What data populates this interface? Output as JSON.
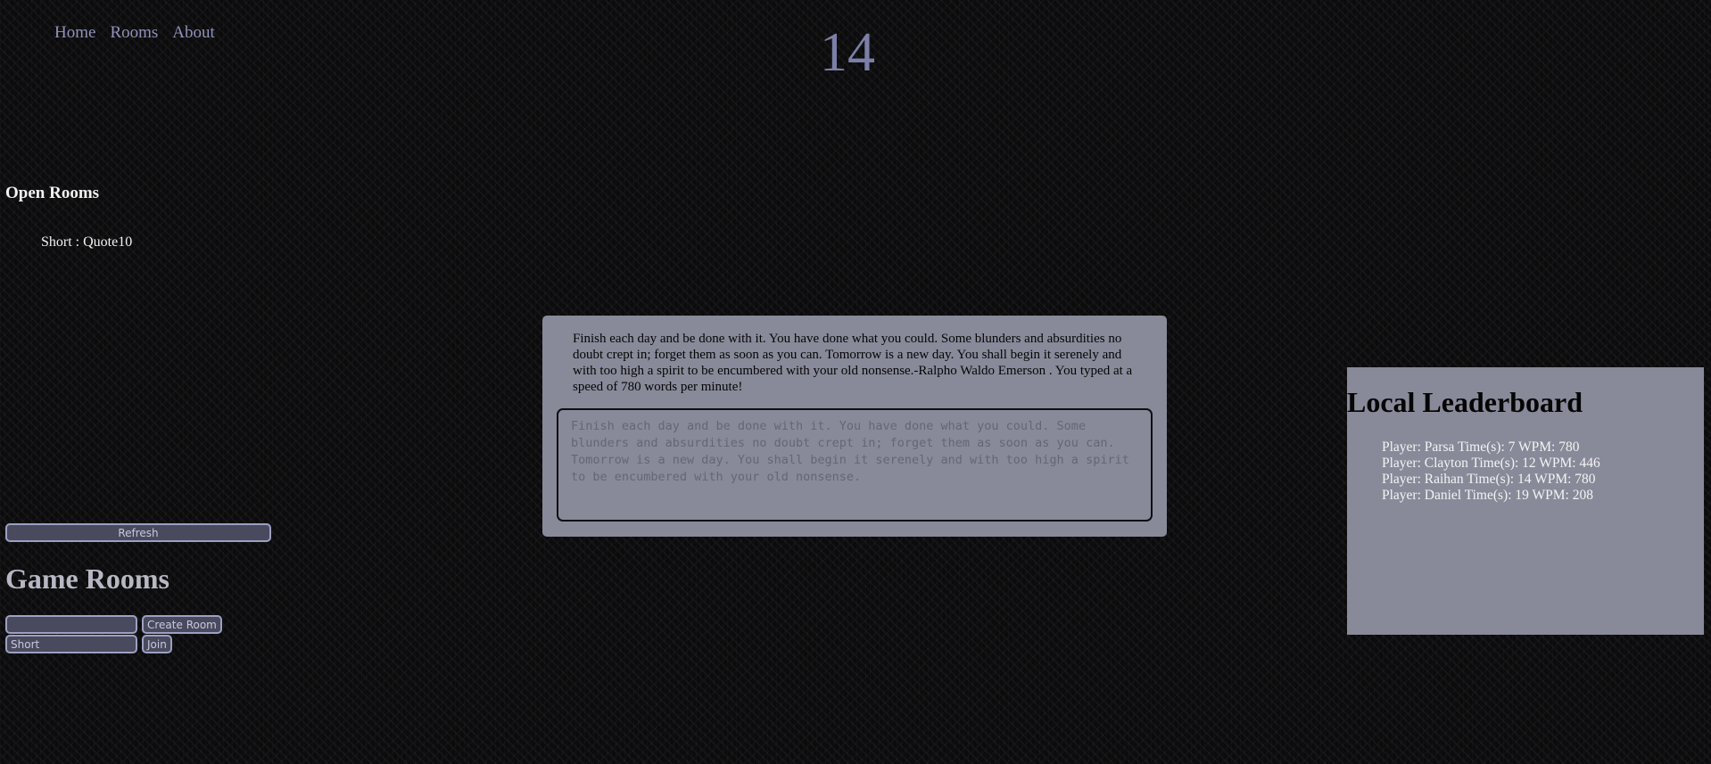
{
  "nav": {
    "home": "Home",
    "rooms": "Rooms",
    "about": "About"
  },
  "timer": "14",
  "open_rooms": {
    "title": "Open Rooms",
    "items": [
      {
        "label": "Short : Quote10"
      }
    ],
    "refresh_label": "Refresh"
  },
  "game_rooms": {
    "title": "Game Rooms",
    "room_name_value": "",
    "room_name_placeholder": "",
    "create_label": "Create Room",
    "join_value": "",
    "join_placeholder": "Short",
    "join_label": "Join"
  },
  "typing": {
    "quote": "Finish each day and be done with it. You have done what you could. Some blunders and absurdities no doubt crept in; forget them as soon as you can. Tomorrow is a new day. You shall begin it serenely and with too high a spirit to be encumbered with your old nonsense.-Ralpho Waldo Emerson . You typed at a speed of 780 words per minute!",
    "input_value": "",
    "input_placeholder": "Finish each day and be done with it. You have done what you could. Some blunders and absurdities no doubt crept in; forget them as soon as you can. Tomorrow is a new day. You shall begin it serenely and with too high a spirit to be encumbered with your old nonsense."
  },
  "leaderboard": {
    "title": "Local Leaderboard",
    "entries": [
      "Player: Parsa Time(s): 7 WPM: 780",
      "Player: Clayton Time(s): 12 WPM: 446",
      "Player: Raihan Time(s): 14 WPM: 780",
      "Player: Daniel Time(s): 19 WPM: 208"
    ]
  },
  "colors": {
    "background": "#0b0b0c",
    "panel": "#888a99",
    "nav_link": "#8f93bb",
    "button_bg": "#4a4a5e",
    "button_border": "#9da0c2"
  }
}
